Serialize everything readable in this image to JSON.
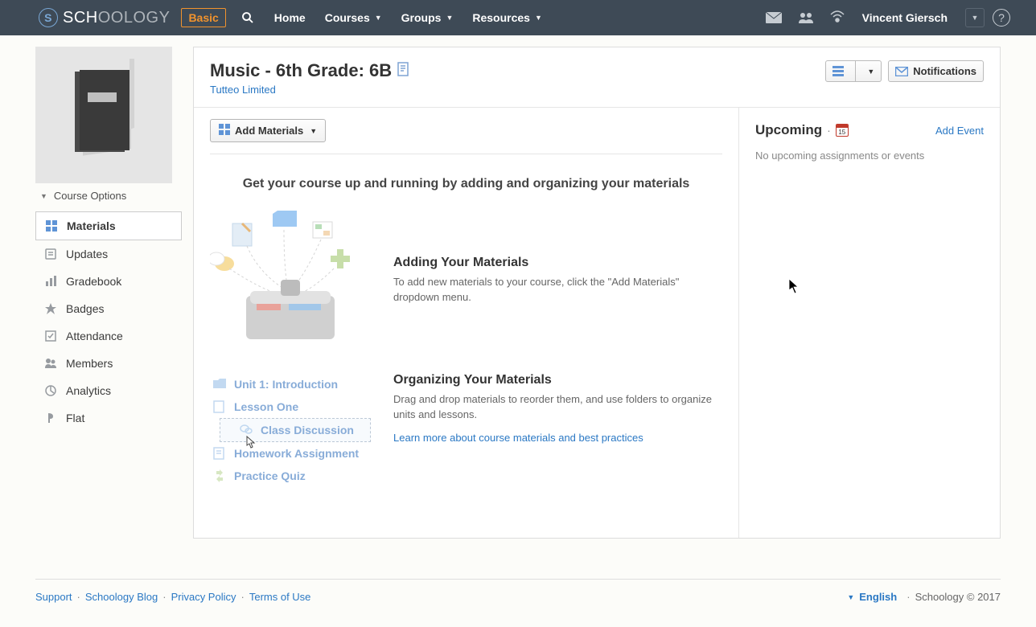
{
  "nav": {
    "basic": "Basic",
    "home": "Home",
    "courses": "Courses",
    "groups": "Groups",
    "resources": "Resources",
    "user": "Vincent Giersch"
  },
  "course_options": "Course Options",
  "side_menu": {
    "materials": "Materials",
    "updates": "Updates",
    "gradebook": "Gradebook",
    "badges": "Badges",
    "attendance": "Attendance",
    "members": "Members",
    "analytics": "Analytics",
    "flat": "Flat"
  },
  "header": {
    "title": "Music - 6th Grade: 6B",
    "org": "Tutteo Limited",
    "notifications": "Notifications"
  },
  "materials": {
    "add_button": "Add Materials",
    "heading": "Get your course up and running by adding and organizing your materials",
    "adding_title": "Adding Your Materials",
    "adding_body": "To add new materials to your course, click the \"Add Materials\" dropdown menu.",
    "organizing_title": "Organizing Your Materials",
    "organizing_body": "Drag and drop materials to reorder them, and use folders to organize units and lessons.",
    "learn_more": "Learn more about course materials and best practices",
    "examples": {
      "unit1": "Unit 1: Introduction",
      "lesson_one": "Lesson One",
      "class_discussion": "Class Discussion",
      "homework": "Homework Assignment",
      "practice_quiz": "Practice Quiz"
    }
  },
  "upcoming": {
    "title": "Upcoming",
    "cal_day": "15",
    "add_event": "Add Event",
    "empty": "No upcoming assignments or events"
  },
  "footer": {
    "support": "Support",
    "blog": "Schoology Blog",
    "privacy": "Privacy Policy",
    "terms": "Terms of Use",
    "language": "English",
    "copyright": "Schoology © 2017"
  }
}
